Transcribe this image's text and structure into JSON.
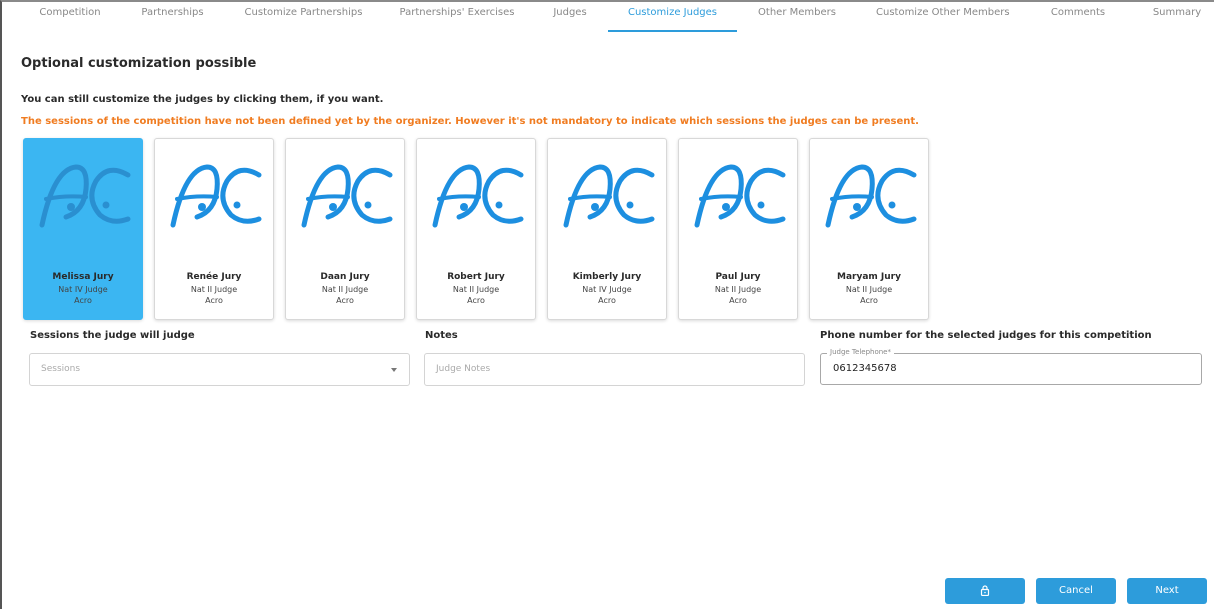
{
  "tabs": [
    {
      "label": "Competition"
    },
    {
      "label": "Partnerships"
    },
    {
      "label": "Customize Partnerships"
    },
    {
      "label": "Partnerships' Exercises"
    },
    {
      "label": "Judges"
    },
    {
      "label": "Customize Judges"
    },
    {
      "label": "Other Members"
    },
    {
      "label": "Customize Other Members"
    },
    {
      "label": "Comments"
    },
    {
      "label": "Summary"
    }
  ],
  "active_tab": "Customize Judges",
  "heading": "Optional customization possible",
  "instruction": "You can still customize the judges by clicking them, if you want.",
  "warning": "The sessions of the competition have not been defined yet by the organizer. However it's not mandatory to indicate which sessions the judges can be present.",
  "logo_text": "AC",
  "judges": [
    {
      "name": "Melissa Jury",
      "level": "Nat IV Judge",
      "discipline": "Acro",
      "selected": true
    },
    {
      "name": "Renée Jury",
      "level": "Nat II Judge",
      "discipline": "Acro",
      "selected": false
    },
    {
      "name": "Daan Jury",
      "level": "Nat II Judge",
      "discipline": "Acro",
      "selected": false
    },
    {
      "name": "Robert Jury",
      "level": "Nat II Judge",
      "discipline": "Acro",
      "selected": false
    },
    {
      "name": "Kimberly Jury",
      "level": "Nat IV Judge",
      "discipline": "Acro",
      "selected": false
    },
    {
      "name": "Paul Jury",
      "level": "Nat II Judge",
      "discipline": "Acro",
      "selected": false
    },
    {
      "name": "Maryam Jury",
      "level": "Nat II Judge",
      "discipline": "Acro",
      "selected": false
    }
  ],
  "form": {
    "sessions_label": "Sessions the judge will judge",
    "sessions_placeholder": "Sessions",
    "notes_label": "Notes",
    "notes_placeholder": "Judge Notes",
    "phone_label": "Phone number for the selected judges for this competition",
    "phone_field_label": "Judge Telephone*",
    "phone_value": "0612345678"
  },
  "buttons": {
    "lock_icon": "lock-icon",
    "cancel": "Cancel",
    "next": "Next"
  },
  "colors": {
    "accent": "#2d9cdb",
    "selected_card": "#3bb6f2",
    "warning": "#f07c21",
    "logo": "#1d8fe0"
  }
}
